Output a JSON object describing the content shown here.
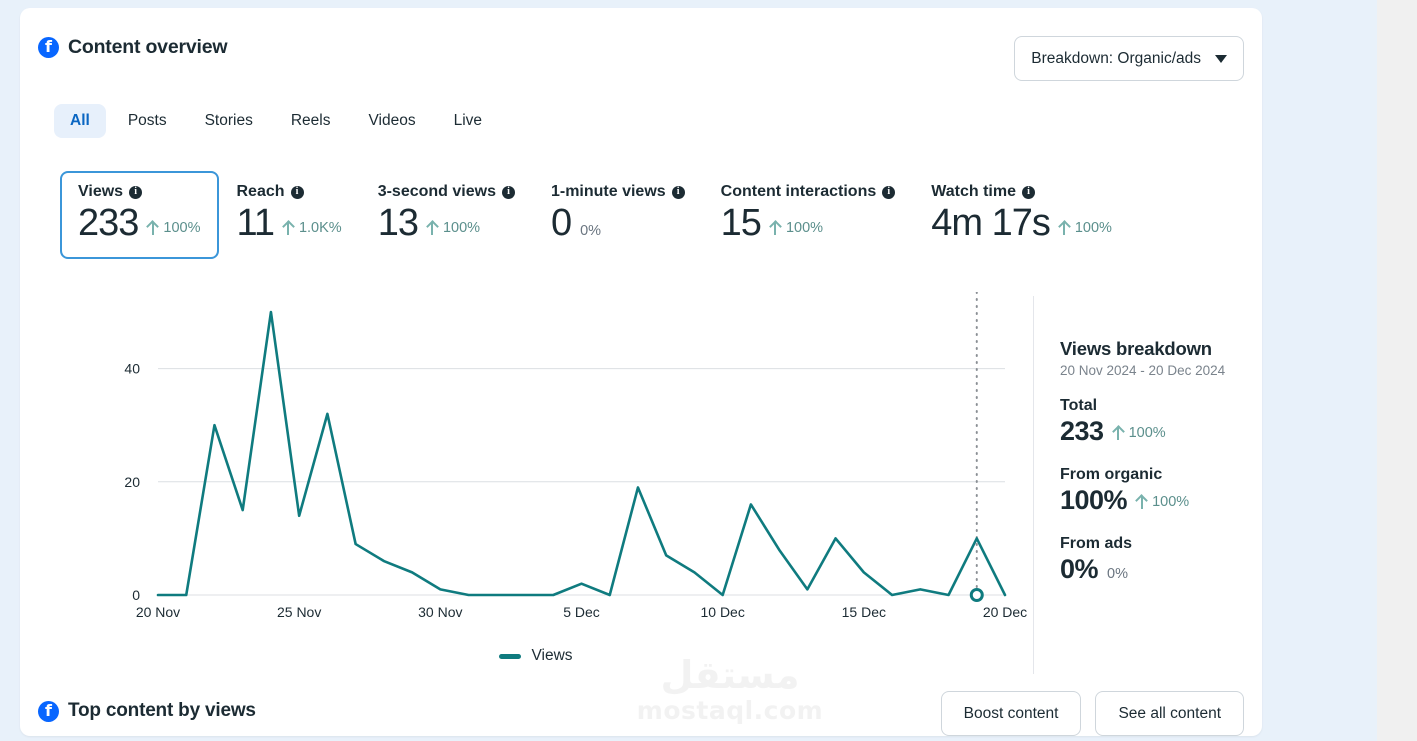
{
  "header": {
    "title": "Content overview",
    "logo_icon": "facebook-icon",
    "breakdown": {
      "label": "Breakdown: Organic/ads",
      "caret_icon": "chevron-down-icon"
    }
  },
  "tabs": [
    {
      "label": "All",
      "active": true
    },
    {
      "label": "Posts",
      "active": false
    },
    {
      "label": "Stories",
      "active": false
    },
    {
      "label": "Reels",
      "active": false
    },
    {
      "label": "Videos",
      "active": false
    },
    {
      "label": "Live",
      "active": false
    }
  ],
  "metrics": [
    {
      "name": "Views",
      "value": "233",
      "delta": "100%",
      "trend": "up",
      "selected": true
    },
    {
      "name": "Reach",
      "value": "11",
      "delta": "1.0K%",
      "trend": "up",
      "selected": false
    },
    {
      "name": "3-second views",
      "value": "13",
      "delta": "100%",
      "trend": "up",
      "selected": false
    },
    {
      "name": "1-minute views",
      "value": "0",
      "delta": "0%",
      "trend": "flat",
      "selected": false
    },
    {
      "name": "Content interactions",
      "value": "15",
      "delta": "100%",
      "trend": "up",
      "selected": false
    },
    {
      "name": "Watch time",
      "value": "4m 17s",
      "delta": "100%",
      "trend": "up",
      "selected": false
    }
  ],
  "breakdown_panel": {
    "title": "Views breakdown",
    "date_range": "20 Nov 2024 - 20 Dec 2024",
    "rows": [
      {
        "label": "Total",
        "value": "233",
        "delta": "100%",
        "trend": "up"
      },
      {
        "label": "From organic",
        "value": "100%",
        "delta": "100%",
        "trend": "up"
      },
      {
        "label": "From ads",
        "value": "0%",
        "delta": "0%",
        "trend": "flat"
      }
    ]
  },
  "footer": {
    "title": "Top content by views",
    "logo_icon": "facebook-icon",
    "boost_button": "Boost content",
    "see_all_button": "See all content"
  },
  "watermark": {
    "arabic": "مستقل",
    "latin": "mostaql.com"
  },
  "colors": {
    "brand_blue": "#0866ff",
    "accent_tab": "#0a66c2",
    "line_teal": "#0f7b7f",
    "delta_green": "#5b8f8c",
    "text_dark": "#1c2b33",
    "page_bg": "#e8f1fa"
  },
  "chart_data": {
    "type": "line",
    "title": "",
    "xlabel": "",
    "ylabel": "",
    "legend": [
      {
        "name": "Views",
        "color": "#0f7b7f"
      }
    ],
    "legend_position": "bottom-center",
    "grid": true,
    "ylim": [
      0,
      50
    ],
    "yticks": [
      0,
      20,
      40
    ],
    "xticks": [
      "20 Nov",
      "25 Nov",
      "30 Nov",
      "5 Dec",
      "10 Dec",
      "15 Dec",
      "20 Dec"
    ],
    "x": [
      "20 Nov",
      "21 Nov",
      "22 Nov",
      "23 Nov",
      "24 Nov",
      "25 Nov",
      "26 Nov",
      "27 Nov",
      "28 Nov",
      "29 Nov",
      "30 Nov",
      "1 Dec",
      "2 Dec",
      "3 Dec",
      "4 Dec",
      "5 Dec",
      "6 Dec",
      "7 Dec",
      "8 Dec",
      "9 Dec",
      "10 Dec",
      "11 Dec",
      "12 Dec",
      "13 Dec",
      "14 Dec",
      "15 Dec",
      "16 Dec",
      "17 Dec",
      "18 Dec",
      "19 Dec",
      "20 Dec"
    ],
    "series": [
      {
        "name": "Views",
        "color": "#0f7b7f",
        "values": [
          0,
          0,
          30,
          15,
          50,
          14,
          32,
          9,
          6,
          4,
          1,
          0,
          0,
          0,
          0,
          2,
          0,
          19,
          7,
          4,
          0,
          16,
          8,
          1,
          10,
          4,
          0,
          1,
          0,
          10,
          0
        ]
      }
    ],
    "marker": {
      "x": "19 Dec",
      "y": 0,
      "style": "hollow-circle",
      "color": "#0f7b7f"
    },
    "reference_line": {
      "x": "19 Dec",
      "style": "dotted",
      "color": "#8a8f94"
    }
  }
}
